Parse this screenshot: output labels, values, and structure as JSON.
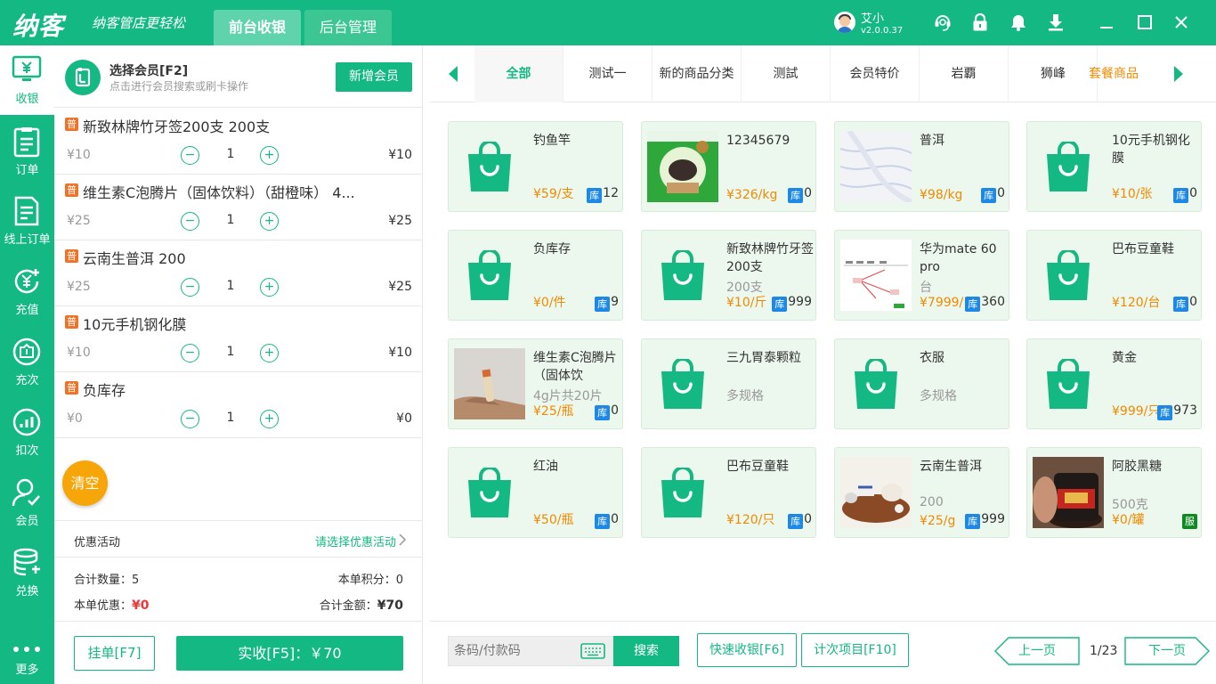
{
  "app": {
    "logo": "纳客",
    "slogan": "纳客管店更轻松",
    "tabs": [
      {
        "label": "前台收银"
      },
      {
        "label": "后台管理"
      }
    ],
    "user": {
      "name": "艾小",
      "version": "v2.0.0.37"
    }
  },
  "nav": [
    {
      "label": "收银",
      "icon": "cashier-icon"
    },
    {
      "label": "订单",
      "icon": "order-icon"
    },
    {
      "label": "线上订单",
      "icon": "online-order-icon"
    },
    {
      "label": "充值",
      "icon": "recharge-icon"
    },
    {
      "label": "充次",
      "icon": "recharge-count-icon"
    },
    {
      "label": "扣次",
      "icon": "deduct-count-icon"
    },
    {
      "label": "会员",
      "icon": "member-icon"
    },
    {
      "label": "兑换",
      "icon": "exchange-icon"
    },
    {
      "label": "更多",
      "icon": "more-icon"
    }
  ],
  "member": {
    "title": "选择会员[F2]",
    "hint": "点击进行会员搜索或刷卡操作",
    "add_label": "新增会员"
  },
  "cart": {
    "badge": "普",
    "items": [
      {
        "name": "新致林牌竹牙签200支 200支",
        "unit": "¥10",
        "qty": "1",
        "total": "¥10"
      },
      {
        "name": "维生素C泡腾片（固体饮料）（甜橙味） 4...",
        "unit": "¥25",
        "qty": "1",
        "total": "¥25"
      },
      {
        "name": "云南生普洱 200",
        "unit": "¥25",
        "qty": "1",
        "total": "¥25"
      },
      {
        "name": "10元手机钢化膜",
        "unit": "¥10",
        "qty": "1",
        "total": "¥10"
      },
      {
        "name": "负库存",
        "unit": "¥0",
        "qty": "1",
        "total": "¥0"
      }
    ],
    "minus": "−",
    "plus": "+",
    "clear_label": "清空",
    "promo_label": "优惠活动",
    "promo_value": "请选择优惠活动",
    "summary": {
      "count_label": "合计数量：",
      "count": "5",
      "points_label": "本单积分：",
      "points": "0",
      "discount_label": "本单优惠：",
      "discount": "¥0",
      "total_label": "合计金额：",
      "total": "¥70"
    },
    "hang_label": "挂单[F7]",
    "pay_label": "实收[F5]：￥70"
  },
  "categories": [
    {
      "label": "全部",
      "active": true
    },
    {
      "label": "测试一"
    },
    {
      "label": "新的商品分类"
    },
    {
      "label": "测試"
    },
    {
      "label": "会员特价"
    },
    {
      "label": "岩覇"
    },
    {
      "label": "狮峰"
    },
    {
      "label": "套餐商品",
      "accent": true
    }
  ],
  "products": [
    {
      "name": "钓鱼竿",
      "price": "¥59/支",
      "stock_badge": "库",
      "stock": "12",
      "img": "bag"
    },
    {
      "name": "12345679",
      "price": "¥326/kg",
      "stock_badge": "库",
      "stock": "0",
      "img": "photo-green"
    },
    {
      "name": "普洱",
      "price": "¥98/kg",
      "stock_badge": "库",
      "stock": "0",
      "img": "photo-light"
    },
    {
      "name": "10元手机钢化膜",
      "price": "¥10/张",
      "stock_badge": "库",
      "stock": "0",
      "img": "bag"
    },
    {
      "name": "负库存",
      "price": "¥0/件",
      "stock_badge": "库",
      "stock": "9",
      "img": "bag"
    },
    {
      "name": "新致林牌竹牙签200支",
      "sub": "200支",
      "price": "¥10/斤",
      "stock_badge": "库",
      "stock": "999",
      "img": "bag"
    },
    {
      "name": "华为mate 60 pro",
      "sub": "台",
      "price": "¥7999/台",
      "stock_badge": "库",
      "stock": "360",
      "img": "photo-diagram"
    },
    {
      "name": "巴布豆童鞋",
      "price": "¥120/台",
      "stock_badge": "库",
      "stock": "0",
      "img": "bag"
    },
    {
      "name": "维生素C泡腾片（固体饮",
      "sub": "4g片共20片",
      "price": "¥25/瓶",
      "stock_badge": "库",
      "stock": "0",
      "img": "photo-hand"
    },
    {
      "name": "三九胃泰颗粒",
      "sub": "多规格",
      "img": "bag"
    },
    {
      "name": "衣服",
      "sub": "多规格",
      "img": "bag"
    },
    {
      "name": "黄金",
      "price": "¥999/只",
      "stock_badge": "库",
      "stock": "973",
      "img": "bag"
    },
    {
      "name": "红油",
      "price": "¥50/瓶",
      "stock_badge": "库",
      "stock": "0",
      "img": "bag"
    },
    {
      "name": "巴布豆童鞋",
      "price": "¥120/只",
      "stock_badge": "库",
      "stock": "0",
      "img": "bag"
    },
    {
      "name": "云南生普洱",
      "sub": "200",
      "price": "¥25/g",
      "stock_badge": "库",
      "stock": "999",
      "img": "photo-tea"
    },
    {
      "name": "阿胶黑糖",
      "sub": "500克",
      "price": "¥0/罐",
      "service_badge": "服",
      "img": "photo-jar"
    }
  ],
  "bottom": {
    "barcode_placeholder": "条码/付款码",
    "search_label": "搜索",
    "quick_label": "快速收银[F6]",
    "count_item_label": "计次项目[F10]",
    "prev_label": "上一页",
    "page": "1/23",
    "next_label": "下一页"
  },
  "colors": {
    "primary": "#14b883",
    "orange": "#f08a00",
    "stock_blue": "#1e88e5",
    "clear": "#f6a609",
    "red": "#f03737"
  }
}
